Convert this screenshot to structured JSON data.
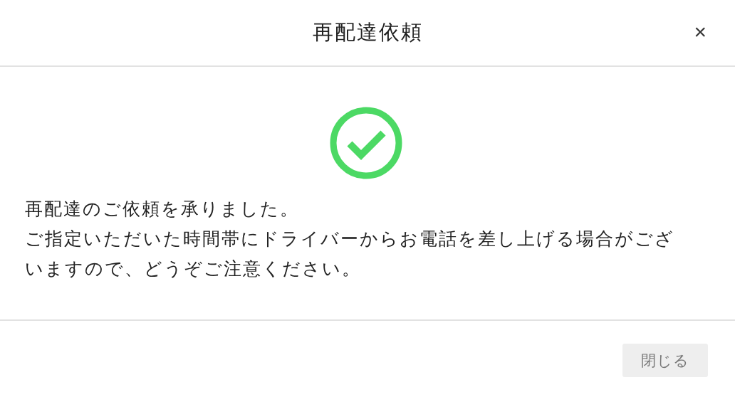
{
  "dialog": {
    "title": "再配達依頼",
    "close": "×"
  },
  "status": {
    "kind": "success"
  },
  "message": [
    "再配達のご依頼を承りました。",
    "ご指定いただいた時間帯にドライバーからお電話を差し上げる場合がございますので、どうぞご注意ください。"
  ],
  "buttons": [
    {
      "label": "閉じる",
      "disabled": true
    }
  ]
}
